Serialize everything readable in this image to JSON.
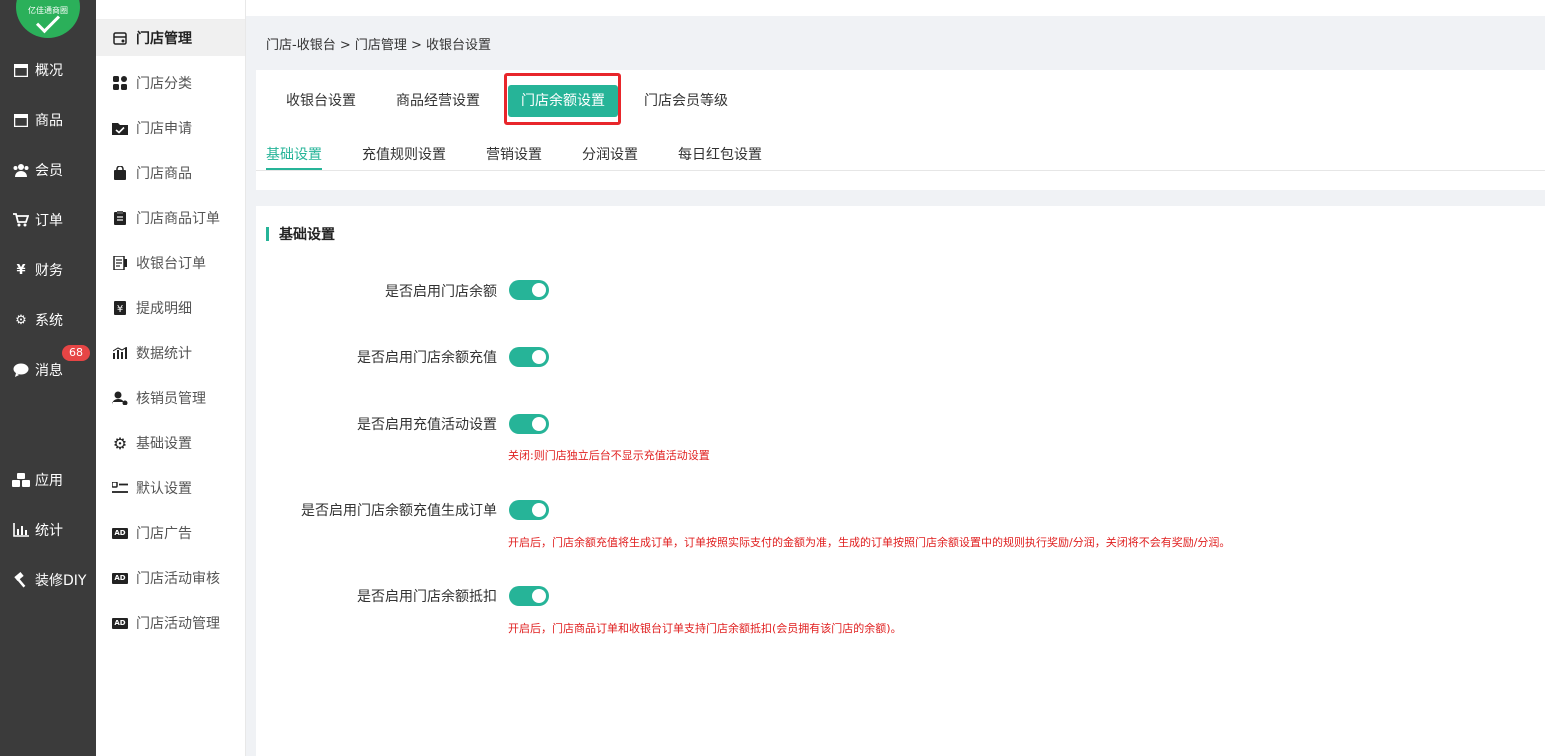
{
  "logo": {
    "text": "亿佳通商圈"
  },
  "rail": {
    "items": [
      {
        "label": "概况",
        "icon": "window-icon"
      },
      {
        "label": "商品",
        "icon": "window-icon"
      },
      {
        "label": "会员",
        "icon": "users-icon"
      },
      {
        "label": "订单",
        "icon": "cart-icon"
      },
      {
        "label": "财务",
        "icon": "yen-icon"
      },
      {
        "label": "系统",
        "icon": "gears-icon"
      },
      {
        "label": "消息",
        "icon": "chat-icon"
      },
      {
        "label": "应用",
        "icon": "cubes-icon"
      },
      {
        "label": "统计",
        "icon": "bar-chart-icon"
      },
      {
        "label": "装修DIY",
        "icon": "hammer-icon"
      }
    ],
    "message_badge": "68"
  },
  "subnav": {
    "items": [
      {
        "label": "门店管理",
        "icon": "store-icon",
        "active": true
      },
      {
        "label": "门店分类",
        "icon": "grid-icon"
      },
      {
        "label": "门店申请",
        "icon": "folder-check-icon"
      },
      {
        "label": "门店商品",
        "icon": "bag-icon"
      },
      {
        "label": "门店商品订单",
        "icon": "clipboard-icon"
      },
      {
        "label": "收银台订单",
        "icon": "receipt-icon"
      },
      {
        "label": "提成明细",
        "icon": "yen-doc-icon"
      },
      {
        "label": "数据统计",
        "icon": "stats-icon"
      },
      {
        "label": "核销员管理",
        "icon": "user-gear-icon"
      },
      {
        "label": "基础设置",
        "icon": "gear-icon"
      },
      {
        "label": "默认设置",
        "icon": "list-icon"
      },
      {
        "label": "门店广告",
        "icon": "ad-icon"
      },
      {
        "label": "门店活动审核",
        "icon": "ad-icon"
      },
      {
        "label": "门店活动管理",
        "icon": "ad-icon"
      }
    ]
  },
  "breadcrumb": "门店-收银台 > 门店管理 > 收银台设置",
  "tabs": [
    {
      "label": "收银台设置"
    },
    {
      "label": "商品经营设置"
    },
    {
      "label": "门店余额设置",
      "active": true
    },
    {
      "label": "门店会员等级"
    }
  ],
  "subtabs": [
    {
      "label": "基础设置",
      "active": true
    },
    {
      "label": "充值规则设置"
    },
    {
      "label": "营销设置"
    },
    {
      "label": "分润设置"
    },
    {
      "label": "每日红包设置"
    }
  ],
  "section_title": "基础设置",
  "settings": [
    {
      "label": "是否启用门店余额",
      "enabled": true,
      "hint": ""
    },
    {
      "label": "是否启用门店余额充值",
      "enabled": true,
      "hint": ""
    },
    {
      "label": "是否启用充值活动设置",
      "enabled": true,
      "hint": "关闭:则门店独立后台不显示充值活动设置"
    },
    {
      "label": "是否启用门店余额充值生成订单",
      "enabled": true,
      "hint": "开启后，门店余额充值将生成订单，订单按照实际支付的金额为准，生成的订单按照门店余额设置中的规则执行奖励/分润，关闭将不会有奖励/分润。"
    },
    {
      "label": "是否启用门店余额抵扣",
      "enabled": true,
      "hint": "开启后，门店商品订单和收银台订单支持门店余额抵扣(会员拥有该门店的余额)。"
    }
  ],
  "colors": {
    "accent": "#26b498",
    "rail_bg": "#3b3b3b",
    "hint_red": "#e02020",
    "highlight_red": "#e8262b"
  }
}
